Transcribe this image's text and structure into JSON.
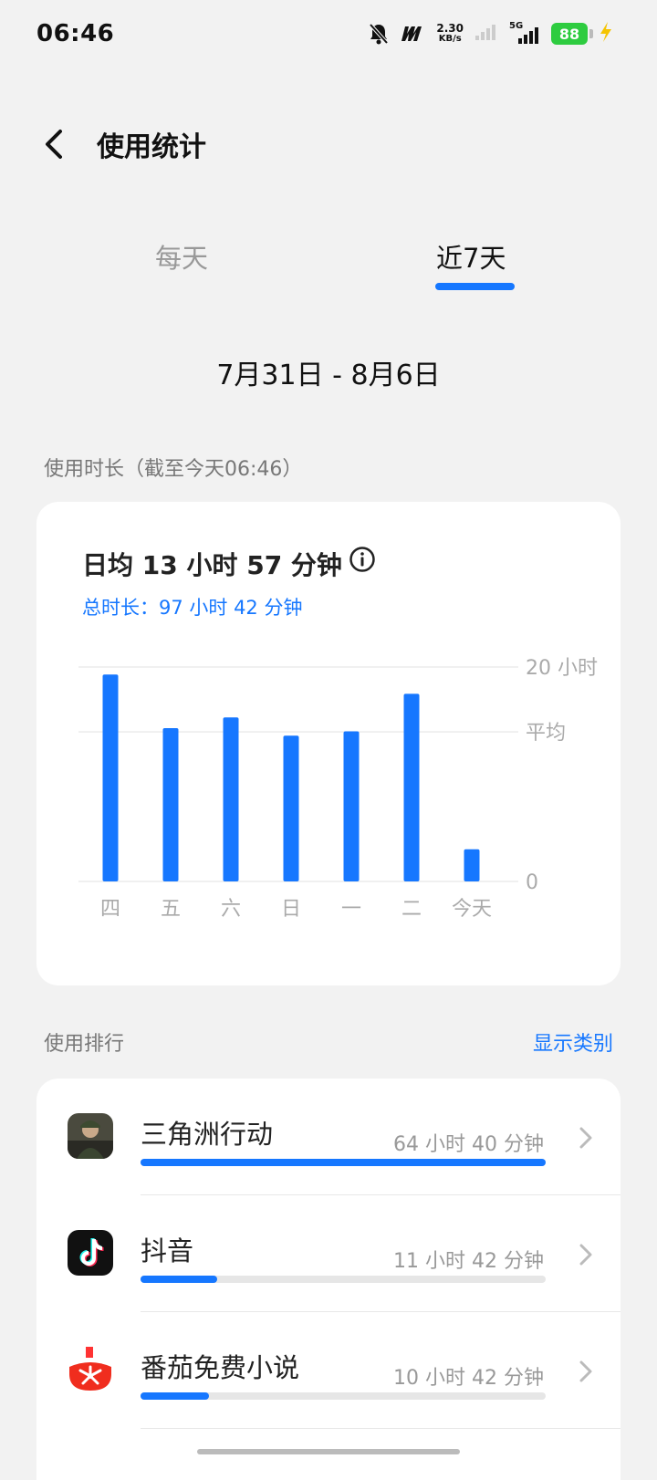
{
  "status_bar": {
    "time": "06:46",
    "net_speed_value": "2.30",
    "net_speed_unit": "KB/s",
    "network_type": "5G",
    "battery": "88"
  },
  "header": {
    "title": "使用统计"
  },
  "tabs": [
    {
      "label": "每天",
      "active": false
    },
    {
      "label": "近7天",
      "active": true
    }
  ],
  "date_range": "7月31日 - 8月6日",
  "usage_section": {
    "label": "使用时长（截至今天06:46）",
    "daily_average": "日均 13 小时 57 分钟",
    "total": "总时长：97 小时 42 分钟"
  },
  "chart_data": {
    "type": "bar",
    "categories": [
      "四",
      "五",
      "六",
      "日",
      "一",
      "二",
      "今天"
    ],
    "values": [
      19.3,
      14.3,
      15.3,
      13.6,
      14.0,
      17.5,
      3.0
    ],
    "ylim": [
      0,
      20
    ],
    "ytick_labels": [
      "20 小时",
      "平均",
      "0"
    ],
    "average_value": 13.95,
    "max_label": "20 小时",
    "average_label": "平均",
    "zero_label": "0",
    "bar_color": "#1677ff"
  },
  "ranking_section": {
    "label": "使用排行",
    "show_category": "显示类别",
    "apps": [
      {
        "name": "三角洲行动",
        "time": "64 小时 40 分钟",
        "fraction": 1.0,
        "icon": "delta-force-app-icon"
      },
      {
        "name": "抖音",
        "time": "11 小时 42 分钟",
        "fraction": 0.19,
        "icon": "douyin-app-icon"
      },
      {
        "name": "番茄免费小说",
        "time": "10 小时 42 分钟",
        "fraction": 0.17,
        "icon": "fanqie-novel-app-icon"
      }
    ]
  },
  "colors": {
    "accent": "#1677ff",
    "background": "#f2f2f2",
    "card": "#ffffff",
    "battery": "#2ecc40"
  }
}
